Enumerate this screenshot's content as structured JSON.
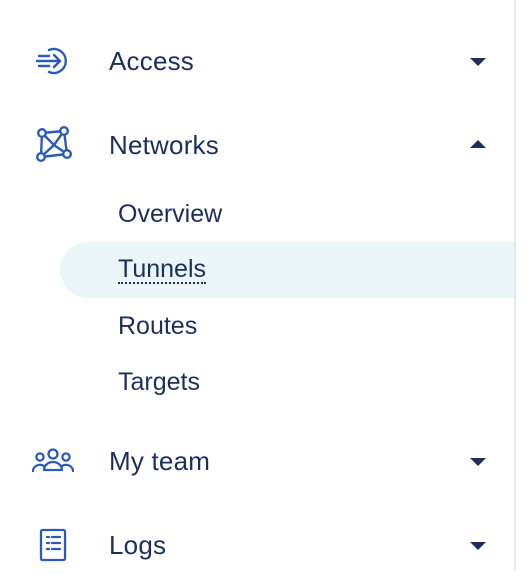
{
  "colors": {
    "text": "#1b2f5b",
    "icon": "#2c5ab8",
    "active_bg": "#e9f5f7"
  },
  "nav": {
    "access": {
      "label": "Access",
      "icon": "access-arrow-icon",
      "expanded": false
    },
    "networks": {
      "label": "Networks",
      "icon": "network-graph-icon",
      "expanded": true,
      "children": [
        {
          "label": "Overview",
          "active": false
        },
        {
          "label": "Tunnels",
          "active": true
        },
        {
          "label": "Routes",
          "active": false
        },
        {
          "label": "Targets",
          "active": false
        }
      ]
    },
    "my_team": {
      "label": "My team",
      "icon": "people-group-icon",
      "expanded": false
    },
    "logs": {
      "label": "Logs",
      "icon": "document-list-icon",
      "expanded": false
    }
  }
}
